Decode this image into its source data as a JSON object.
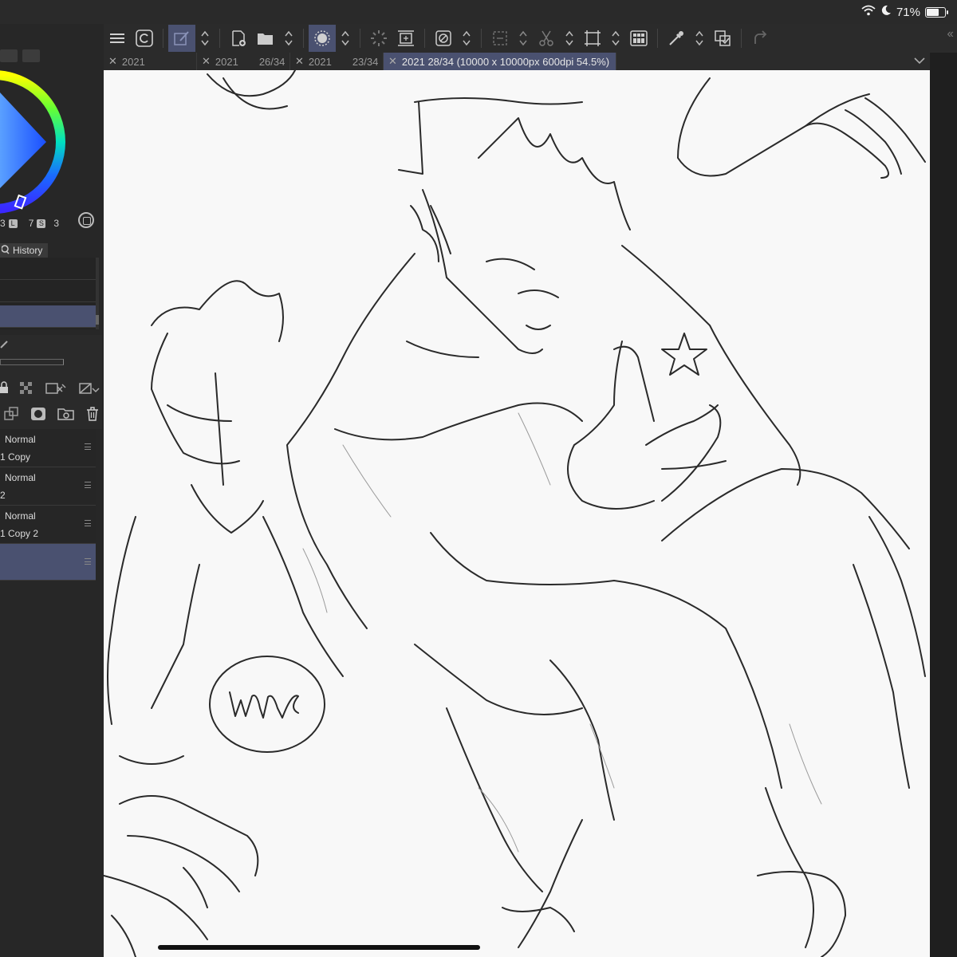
{
  "status": {
    "battery_percent_label": "71%",
    "battery_level": 0.71,
    "icons": [
      "wifi-icon",
      "moon-icon",
      "battery-icon"
    ]
  },
  "toolbar": {
    "icons": [
      "menu-icon",
      "clip-studio-logo-icon",
      "edit-icon",
      "up-down-arrows-icon",
      "new-canvas-icon",
      "open-folder-icon",
      "up-down-arrows-icon",
      "brush-size-icon",
      "up-down-arrows-icon",
      "spinner-icon",
      "fit-canvas-icon",
      "transform-icon",
      "up-down-arrows-icon",
      "selection-icon",
      "up-down-arrows-icon",
      "cut-icon",
      "up-down-arrows-icon",
      "crop-icon",
      "up-down-arrows-icon",
      "grid-icon",
      "eyedropper-icon",
      "up-down-arrows-icon",
      "layer-transfer-icon",
      "redo-icon"
    ],
    "accent": "#4a5170"
  },
  "tabs": [
    {
      "label": "2021",
      "sub": ""
    },
    {
      "label": "2021",
      "sub": "26/34"
    },
    {
      "label": "2021",
      "sub": "23/34"
    },
    {
      "label": "2021 28/34 (10000 x 10000px 600dpi 54.5%)",
      "sub": "",
      "active": true
    }
  ],
  "color_panel": {
    "values": [
      "3",
      "7",
      "3"
    ],
    "badges": [
      "L",
      "S"
    ]
  },
  "history": {
    "tab_label": "History"
  },
  "layers": [
    {
      "mode": "Normal",
      "name": "1 Copy"
    },
    {
      "mode": "Normal",
      "name": "2"
    },
    {
      "mode": "Normal",
      "name": "1 Copy 2"
    },
    {
      "mode": "",
      "name": "",
      "selected": true
    }
  ],
  "colors": {
    "panel_bg": "#272727",
    "canvas_bg": "#f8f8f8",
    "selection": "#4a5170",
    "stroke": "#2a2a2a"
  }
}
